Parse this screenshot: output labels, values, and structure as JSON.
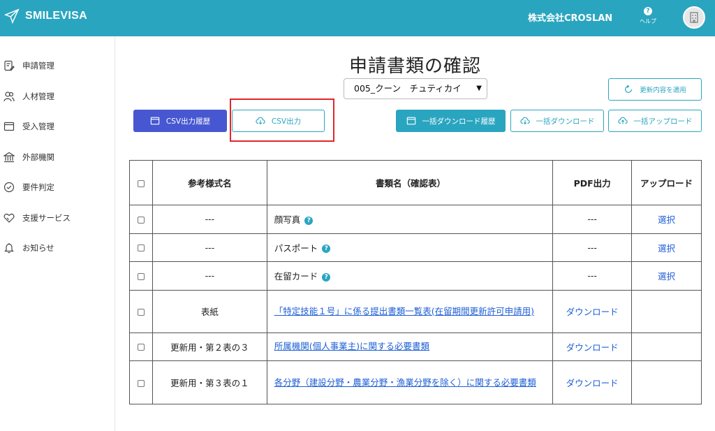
{
  "header": {
    "logo_text": "SMILEVISA",
    "company": "株式会社CROSLAN",
    "help_label": "ヘルプ",
    "help_glyph": "?"
  },
  "sidebar": {
    "items": [
      {
        "label": "申請管理",
        "icon": "document-edit-icon"
      },
      {
        "label": "人材管理",
        "icon": "people-icon"
      },
      {
        "label": "受入管理",
        "icon": "window-icon"
      },
      {
        "label": "外部機関",
        "icon": "building-icon"
      },
      {
        "label": "要件判定",
        "icon": "check-circle-icon"
      },
      {
        "label": "支援サービス",
        "icon": "heart-handshake-icon"
      },
      {
        "label": "お知らせ",
        "icon": "bell-icon"
      }
    ]
  },
  "main": {
    "title": "申請書類の確認",
    "person_select": "005_クーン　チュティカイ",
    "buttons": {
      "update": "更新内容を適用",
      "csv_history": "CSV出力履歴",
      "csv_export": "CSV出力",
      "download_history": "一括ダウンロード履歴",
      "bulk_download": "一括ダウンロード",
      "bulk_upload": "一括アップロード"
    }
  },
  "table": {
    "headers": {
      "ref": "参考様式名",
      "doc": "書類名（確認表）",
      "pdf": "PDF出力",
      "upload": "アップロード"
    },
    "rows": [
      {
        "ref": "---",
        "doc": "顔写真",
        "pdf": "---",
        "upload": "選択"
      },
      {
        "ref": "---",
        "doc": "パスポート",
        "pdf": "---",
        "upload": "選択"
      },
      {
        "ref": "---",
        "doc": "在留カード",
        "pdf": "---",
        "upload": "選択"
      },
      {
        "ref": "表紙",
        "doc": "「特定技能１号」に係る提出書類一覧表(在留期間更新許可申請用)",
        "pdf": "ダウンロード",
        "upload": ""
      },
      {
        "ref": "更新用・第２表の３",
        "doc": "所属機関(個人事業主)に関する必要書類",
        "pdf": "ダウンロード",
        "upload": ""
      },
      {
        "ref": "更新用・第３表の１",
        "doc": "各分野（建設分野・農業分野・漁業分野を除く）に関する必要書類",
        "pdf": "ダウンロード",
        "upload": ""
      }
    ]
  },
  "colors": {
    "primary": "#2aa5c0",
    "indigo": "#4757d1",
    "link": "#1e5fd6",
    "highlight": "#e3242b"
  }
}
